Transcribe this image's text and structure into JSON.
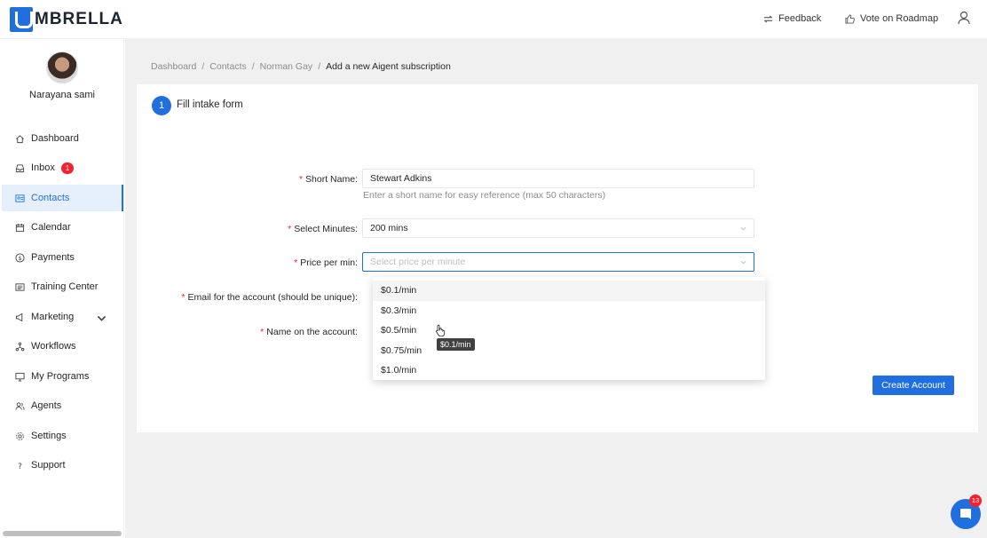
{
  "app": {
    "brand": "MBRELLA",
    "feedback_label": "Feedback",
    "roadmap_label": "Vote on Roadmap"
  },
  "user": {
    "name": "Narayana sami"
  },
  "sidebar": {
    "items": [
      {
        "label": "Dashboard",
        "icon": "home-icon"
      },
      {
        "label": "Inbox",
        "icon": "inbox-icon",
        "badge": "1"
      },
      {
        "label": "Contacts",
        "icon": "contacts-icon",
        "active": true
      },
      {
        "label": "Calendar",
        "icon": "calendar-icon"
      },
      {
        "label": "Payments",
        "icon": "dollar-icon"
      },
      {
        "label": "Training Center",
        "icon": "training-icon"
      },
      {
        "label": "Marketing",
        "icon": "megaphone-icon",
        "expandable": true
      },
      {
        "label": "Workflows",
        "icon": "workflow-icon"
      },
      {
        "label": "My Programs",
        "icon": "monitor-icon"
      },
      {
        "label": "Agents",
        "icon": "agents-icon"
      },
      {
        "label": "Settings",
        "icon": "gear-icon"
      },
      {
        "label": "Support",
        "icon": "question-icon"
      }
    ]
  },
  "breadcrumb": {
    "items": [
      "Dashboard",
      "Contacts",
      "Norman Gay"
    ],
    "current": "Add a new Aigent subscription",
    "separator": "/"
  },
  "form": {
    "step_number": "1",
    "step_title": "Fill intake form",
    "short_name": {
      "label": "Short Name",
      "value": "Stewart Adkins",
      "hint": "Enter a short name for easy reference (max 50 characters)"
    },
    "minutes": {
      "label": "Select Minutes",
      "value": "200 mins"
    },
    "price": {
      "label": "Price per min",
      "placeholder": "Select price per minute"
    },
    "email": {
      "label": "Email for the account (should be unique)"
    },
    "account_name": {
      "label": "Name on the account"
    },
    "label_suffix": ":",
    "submit_label": "Create Account"
  },
  "price_options": [
    "$0.1/min",
    "$0.3/min",
    "$0.5/min",
    "$0.75/min",
    "$1.0/min"
  ],
  "tooltip": "$0.1/min",
  "chat": {
    "unread": "13"
  },
  "colors": {
    "primary": "#1f6fe0",
    "danger": "#f5222d",
    "background": "#f0f0f0"
  }
}
